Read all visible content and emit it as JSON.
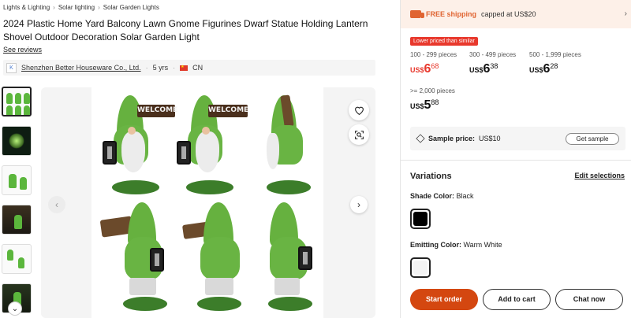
{
  "breadcrumbs": [
    "Lights & Lighting",
    "Solar lighting",
    "Solar Garden Lights"
  ],
  "product": {
    "title": "2024 Plastic Home Yard Balcony Lawn Gnome Figurines Dwarf Statue Holding Lantern Shovel Outdoor Decoration Solar Garden Light",
    "see_reviews": "See reviews"
  },
  "supplier": {
    "logo_letter": "K",
    "name": "Shenzhen Better Houseware Co., Ltd.",
    "years": "5 yrs",
    "country": "CN"
  },
  "gallery": {
    "sign_text": "WELCOME",
    "thumbnail_count": 6
  },
  "shipping": {
    "free_label": "FREE shipping",
    "cap_text": "capped at US$20"
  },
  "pricing": {
    "badge": "Lower priced than similar",
    "tiers": [
      {
        "qty": "100 - 299 pieces",
        "currency": "US$",
        "int": "6",
        "dec": "68"
      },
      {
        "qty": "300 - 499 pieces",
        "currency": "US$",
        "int": "6",
        "dec": "38"
      },
      {
        "qty": "500 - 1,999 pieces",
        "currency": "US$",
        "int": "6",
        "dec": "28"
      },
      {
        "qty": ">= 2,000 pieces",
        "currency": "US$",
        "int": "5",
        "dec": "88"
      }
    ]
  },
  "sample": {
    "label": "Sample price:",
    "value": "US$10",
    "button": "Get sample"
  },
  "variations": {
    "title": "Variations",
    "edit_label": "Edit selections",
    "options": [
      {
        "name": "Shade Color:",
        "value": "Black",
        "swatch": "#000000"
      },
      {
        "name": "Emitting Color:",
        "value": "Warm White",
        "swatch": "#f3f3f3"
      }
    ]
  },
  "actions": {
    "start_order": "Start order",
    "add_to_cart": "Add to cart",
    "chat_now": "Chat now"
  }
}
